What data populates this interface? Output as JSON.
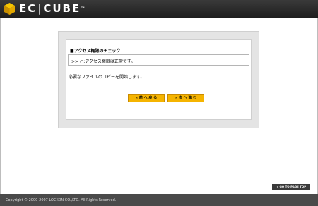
{
  "header": {
    "brand_left": "EC",
    "brand_sep": "|",
    "brand_right": "CUBE",
    "brand_tm": "™"
  },
  "dialog": {
    "section_title": "■アクセス権限のチェック",
    "result": ">> ○:アクセス権限は正常です。",
    "message": "必要なファイルのコピーを開始します。",
    "prev_button": "« 前 へ 戻 る",
    "next_button": "» 次 へ 進 む"
  },
  "pagetop_label": "↑ GO TO PAGE TOP",
  "footer": {
    "copyright": "Copyright © 2000-2007 LOCKON CO.,LTD. All Rights Reserved."
  },
  "colors": {
    "header_bg": "#2a2a2a",
    "footer_bg": "#4a4a4a",
    "button_bg": "#f5b400",
    "logo_accent": "#f0b400"
  }
}
